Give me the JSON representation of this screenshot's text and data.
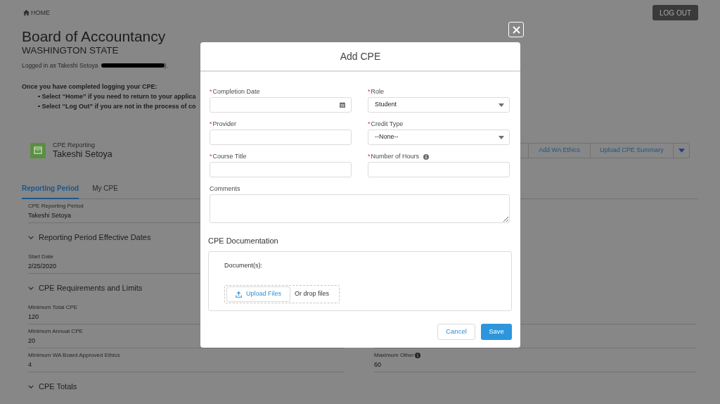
{
  "header": {
    "home_link": "HOME",
    "logout_button": "LOG OUT"
  },
  "title": "Board of Accountancy",
  "subtitle": "WASHINGTON STATE",
  "login": {
    "prefix": "Logged in as Takeshi Setoya",
    "suffix": ")."
  },
  "instructions": {
    "heading": "Once you have completed logging your CPE:",
    "bullets": [
      "Select “Home” if you need to return to your applica",
      "Select “Log Out” if you are not in the process of co"
    ]
  },
  "record": {
    "object_label": "CPE Reporting",
    "name": "Takeshi Setoya",
    "actions": [
      "Add WA Ethics",
      "Upload CPE Summary"
    ]
  },
  "tabs": [
    {
      "label": "Reporting Period",
      "selected": true
    },
    {
      "label": "My CPE",
      "selected": false
    }
  ],
  "content": [
    {
      "kind": "fields",
      "left": [
        {
          "label": "CPE Reporting Period",
          "value": "Takeshi Setoya"
        }
      ]
    },
    {
      "kind": "section",
      "title": "Reporting Period Effective Dates",
      "expanded": true,
      "left": [
        {
          "label": "Start Date",
          "value": "2/25/2020"
        }
      ]
    },
    {
      "kind": "section",
      "title": "CPE Requirements and Limits",
      "expanded": true,
      "left": [
        {
          "label": "Minimum Total CPE",
          "value": "120"
        },
        {
          "label": "Minimum Annual CPE",
          "value": "20"
        },
        {
          "label": "Minimum WA Board Approved Ethics",
          "value": "4"
        }
      ],
      "right": [
        {
          "label": "Maximum Other",
          "value": "60",
          "info": true
        }
      ]
    },
    {
      "kind": "section",
      "title": "CPE Totals",
      "expanded": true
    }
  ],
  "modal": {
    "title": "Add CPE",
    "fields": [
      {
        "kind": "date",
        "label": "Completion Date",
        "marker": "*"
      },
      {
        "kind": "select",
        "label": "Role",
        "marker": "*",
        "value": "Student"
      },
      {
        "kind": "text",
        "label": "Provider",
        "marker": "*"
      },
      {
        "kind": "select",
        "label": "Credit Type",
        "marker": "*",
        "value": "--None--"
      },
      {
        "kind": "text",
        "label": "Course Title",
        "marker": "*"
      },
      {
        "kind": "text",
        "label": "Number of Hours",
        "marker": "*",
        "info": true
      },
      {
        "kind": "textarea",
        "label": "Comments"
      }
    ],
    "documentation": {
      "title": "CPE Documentation",
      "label": "Document(s):",
      "upload_button": "Upload Files",
      "drop_hint": "Or drop files"
    },
    "buttons": [
      {
        "label": "Cancel",
        "kind": "neutral"
      },
      {
        "label": "Save",
        "kind": "brand"
      }
    ]
  }
}
